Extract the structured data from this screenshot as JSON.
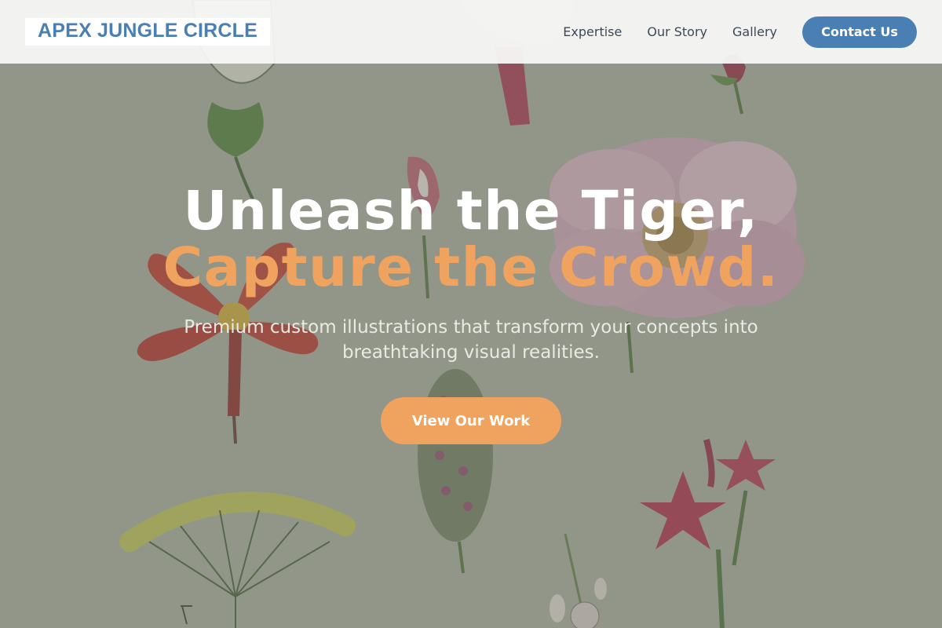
{
  "header": {
    "logo_text": "APEX JUNGLE CIRCLE",
    "nav": [
      {
        "label": "Expertise"
      },
      {
        "label": "Our Story"
      },
      {
        "label": "Gallery"
      }
    ],
    "contact_label": "Contact Us"
  },
  "hero": {
    "headline_line1": "Unleash the Tiger,",
    "headline_line2": "Capture the Crowd.",
    "subtitle": "Premium custom illustrations that transform your concepts into breathtaking visual realities.",
    "cta_label": "View Our Work"
  },
  "colors": {
    "brand_blue": "#4a7fb3",
    "accent_orange": "#f0a35e",
    "background": "#a7ad9f"
  }
}
